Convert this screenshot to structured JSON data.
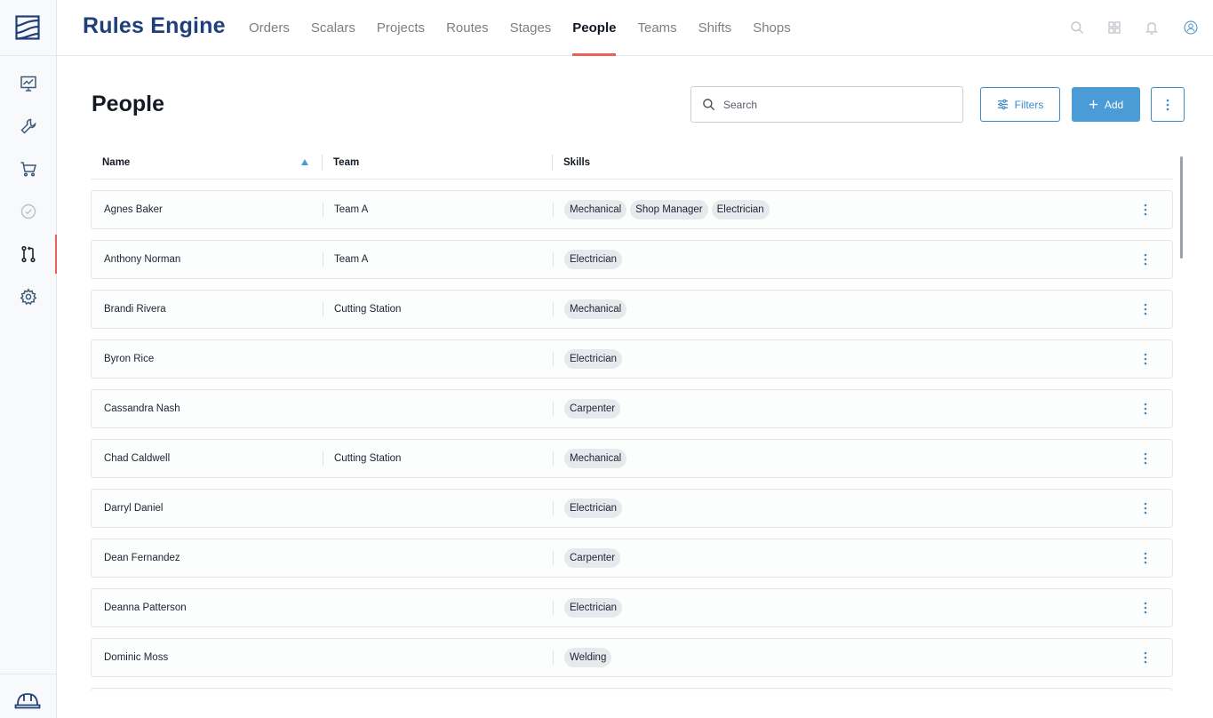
{
  "colors": {
    "brand": "#1f3f7a",
    "accent": "#e8615a",
    "primary": "#4a9bd6",
    "chip_bg": "#e7eaed"
  },
  "sidebar": {
    "logo_icon": "brand-logo-icon",
    "items": [
      {
        "icon": "chart-icon",
        "active": false
      },
      {
        "icon": "wrench-icon",
        "active": false
      },
      {
        "icon": "cart-icon",
        "active": false
      },
      {
        "icon": "check-circle-icon",
        "active": false
      },
      {
        "icon": "rules-branch-icon",
        "active": true
      },
      {
        "icon": "gear-icon",
        "active": false
      }
    ],
    "bottom_icon": "hard-hat-icon"
  },
  "header": {
    "title": "Rules Engine",
    "tabs": [
      {
        "label": "Orders",
        "active": false
      },
      {
        "label": "Scalars",
        "active": false
      },
      {
        "label": "Projects",
        "active": false
      },
      {
        "label": "Routes",
        "active": false
      },
      {
        "label": "Stages",
        "active": false
      },
      {
        "label": "People",
        "active": true
      },
      {
        "label": "Teams",
        "active": false
      },
      {
        "label": "Shifts",
        "active": false
      },
      {
        "label": "Shops",
        "active": false
      }
    ],
    "icons": [
      "search-icon",
      "grid-icon",
      "bell-icon",
      "user-icon"
    ]
  },
  "main": {
    "title": "People",
    "search": {
      "placeholder": "Search",
      "value": ""
    },
    "filters_label": "Filters",
    "add_label": "Add",
    "table": {
      "columns": [
        "Name",
        "Team",
        "Skills"
      ],
      "sort": {
        "column": "Name",
        "direction": "asc"
      },
      "rows": [
        {
          "name": "Agnes Baker",
          "team": "Team A",
          "skills": [
            "Mechanical",
            "Shop Manager",
            "Electrician"
          ]
        },
        {
          "name": "Anthony Norman",
          "team": "Team A",
          "skills": [
            "Electrician"
          ]
        },
        {
          "name": "Brandi Rivera",
          "team": "Cutting Station",
          "skills": [
            "Mechanical"
          ]
        },
        {
          "name": "Byron Rice",
          "team": "",
          "skills": [
            "Electrician"
          ]
        },
        {
          "name": "Cassandra Nash",
          "team": "",
          "skills": [
            "Carpenter"
          ]
        },
        {
          "name": "Chad Caldwell",
          "team": "Cutting Station",
          "skills": [
            "Mechanical"
          ]
        },
        {
          "name": "Darryl Daniel",
          "team": "",
          "skills": [
            "Electrician"
          ]
        },
        {
          "name": "Dean Fernandez",
          "team": "",
          "skills": [
            "Carpenter"
          ]
        },
        {
          "name": "Deanna Patterson",
          "team": "",
          "skills": [
            "Electrician"
          ]
        },
        {
          "name": "Dominic Moss",
          "team": "",
          "skills": [
            "Welding"
          ]
        }
      ]
    }
  }
}
